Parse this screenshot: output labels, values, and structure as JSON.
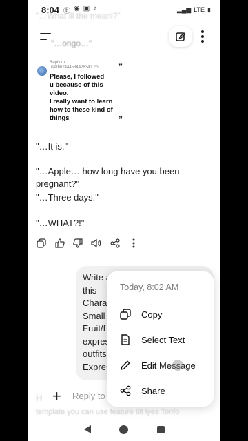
{
  "status_bar": {
    "time": "8:04",
    "network": "LTE"
  },
  "ghost": {
    "top": "\"…What ill the meani?\"",
    "top2": "\"…ongo…\"",
    "bottom_h": "H",
    "bottom": "template you can use feature tilt lyes Tonfo"
  },
  "reply": {
    "label": "Reply to",
    "user": "user6b244458442834's co...",
    "text": "Please, I followed\nu because of this\nvideo.\nI really want to learn\nhow to these kind of\nthings"
  },
  "story": [
    "\"…It is.\"",
    "\"…Apple… how long have you been pregnant?\"",
    "\"…Three days.\"",
    "\"…WHAT?!\""
  ],
  "user_message_visible": [
    "Write a",
    "this",
    "Charac",
    "Small",
    "Fruit/f",
    "expres",
    "outfits",
    "Expres"
  ],
  "context_menu": {
    "timestamp": "Today, 8:02 AM",
    "items": [
      {
        "label": "Copy",
        "icon": "copy-icon"
      },
      {
        "label": "Select Text",
        "icon": "document-icon"
      },
      {
        "label": "Edit Message",
        "icon": "pencil-icon"
      },
      {
        "label": "Share",
        "icon": "share-icon"
      }
    ]
  },
  "composer": {
    "placeholder": "Reply to"
  }
}
